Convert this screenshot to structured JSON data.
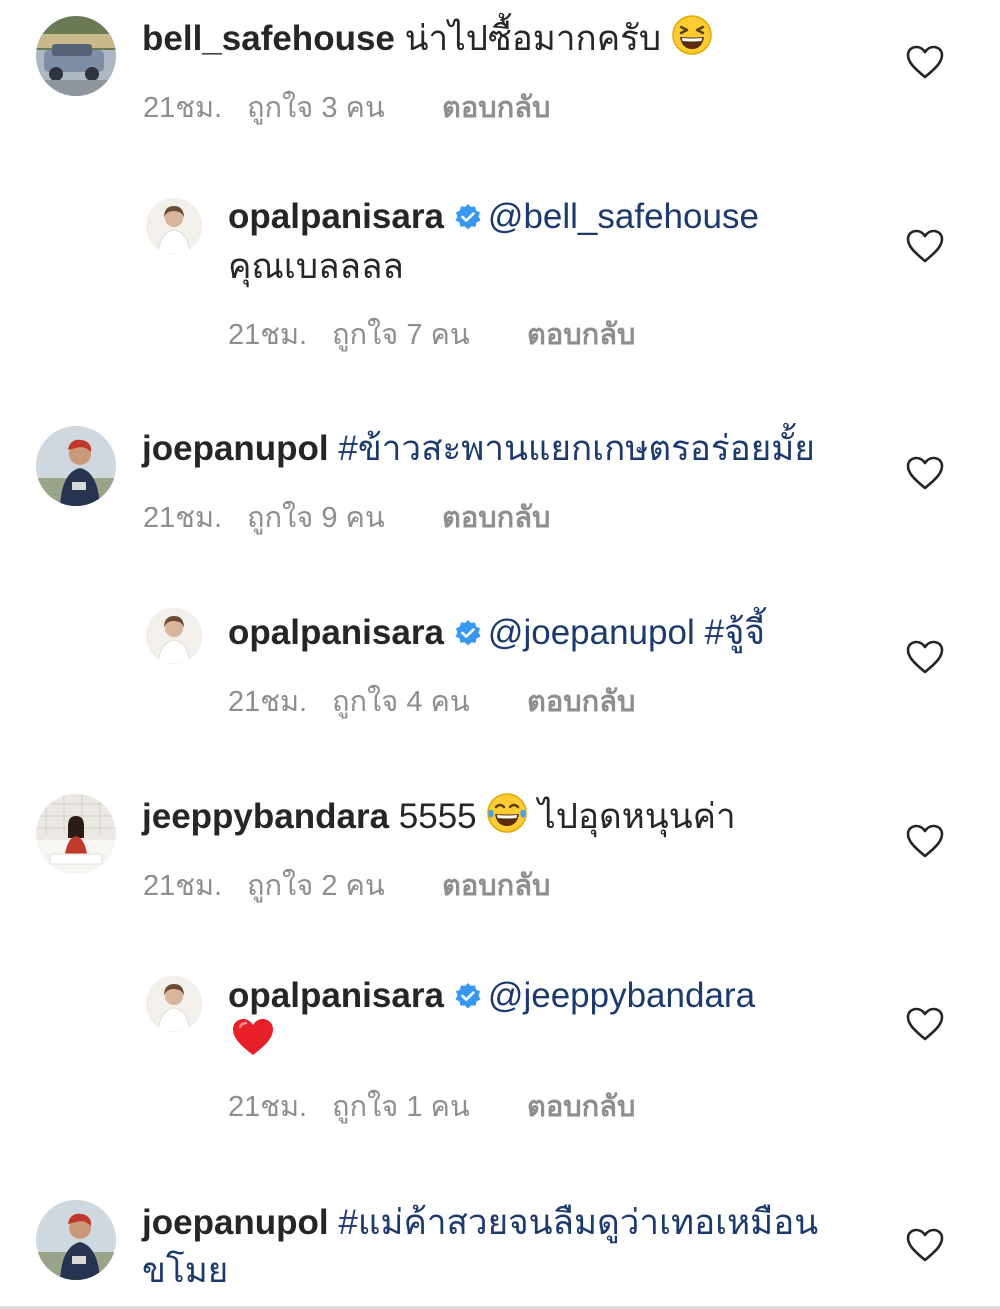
{
  "comments": [
    {
      "username": "bell_safehouse",
      "text": "น่าไปซื้อมากครับ",
      "emoji": "grinning-squinting-face",
      "time": "21ชม.",
      "likes": "ถูกใจ 3 คน",
      "reply": "ตอบกลับ",
      "avatar": "car-photo"
    },
    {
      "username": "opalpanisara",
      "mention": "@bell_safehouse",
      "text": "คุณเบลลลล",
      "time": "21ชม.",
      "likes": "ถูกใจ 7 คน",
      "reply": "ตอบกลับ",
      "verified": true
    },
    {
      "username": "joepanupol",
      "hashtag": "#ข้าวสะพานแยกเกษตรอร่อยมั้ย",
      "time": "21ชม.",
      "likes": "ถูกใจ 9 คน",
      "reply": "ตอบกลับ"
    },
    {
      "username": "opalpanisara",
      "mention": "@joepanupol",
      "hashtag": "#จู้จี้",
      "time": "21ชม.",
      "likes": "ถูกใจ 4 คน",
      "reply": "ตอบกลับ",
      "verified": true
    },
    {
      "username": "jeeppybandara",
      "text": "5555",
      "emoji": "face-with-tears-of-joy",
      "text2": "ไปอุดหนุนค่า",
      "time": "21ชม.",
      "likes": "ถูกใจ 2 คน",
      "reply": "ตอบกลับ"
    },
    {
      "username": "opalpanisara",
      "mention": "@jeeppybandara",
      "emoji": "red-heart",
      "time": "21ชม.",
      "likes": "ถูกใจ 1 คน",
      "reply": "ตอบกลับ",
      "verified": true
    },
    {
      "username": "joepanupol",
      "hashtag": "#แม่ค้าสวยจนลืมดูว่าเทอเหมือน",
      "hashtag_line2": "ขโมย"
    }
  ],
  "colors": {
    "username": "#262626",
    "meta": "#8e8e8e",
    "link": "#1d3a6e",
    "verified": "#3897f0"
  }
}
